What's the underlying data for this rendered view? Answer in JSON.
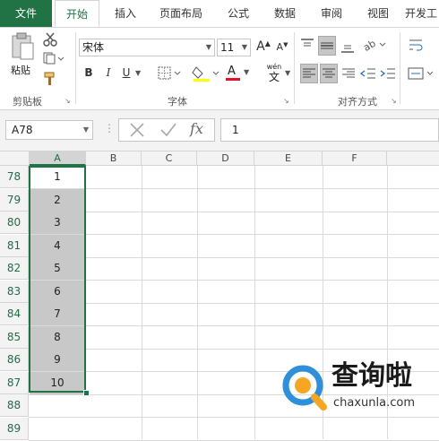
{
  "tabs": [
    "文件",
    "开始",
    "插入",
    "页面布局",
    "公式",
    "数据",
    "审阅",
    "视图",
    "开发工"
  ],
  "ribbon": {
    "paste_label": "粘贴",
    "clipboard_label": "剪贴板",
    "font_name": "宋体",
    "font_size": "11",
    "font_group_label": "字体",
    "align_group_label": "对齐方式",
    "grow_font": "A",
    "shrink_font": "A",
    "bold": "B",
    "italic": "I",
    "underline": "U",
    "font_color_letter": "A",
    "wen_top": "wén",
    "wen_char": "文"
  },
  "formula_bar": {
    "name_box": "A78",
    "fx": "fx",
    "value": "1"
  },
  "columns": [
    "A",
    "B",
    "C",
    "D",
    "E",
    "F"
  ],
  "rows": [
    {
      "num": "78",
      "a": "1"
    },
    {
      "num": "79",
      "a": "2"
    },
    {
      "num": "80",
      "a": "3"
    },
    {
      "num": "81",
      "a": "4"
    },
    {
      "num": "82",
      "a": "5"
    },
    {
      "num": "83",
      "a": "6"
    },
    {
      "num": "84",
      "a": "7"
    },
    {
      "num": "85",
      "a": "8"
    },
    {
      "num": "86",
      "a": "9"
    },
    {
      "num": "87",
      "a": "10"
    },
    {
      "num": "88",
      "a": ""
    },
    {
      "num": "89",
      "a": ""
    }
  ],
  "watermark": {
    "title": "查询啦",
    "url": "chaxunla.com"
  },
  "colors": {
    "accent": "#217346",
    "selection_fill": "#c8c8c8",
    "fill_highlight": "#ffff00",
    "font_color": "#e81123"
  }
}
